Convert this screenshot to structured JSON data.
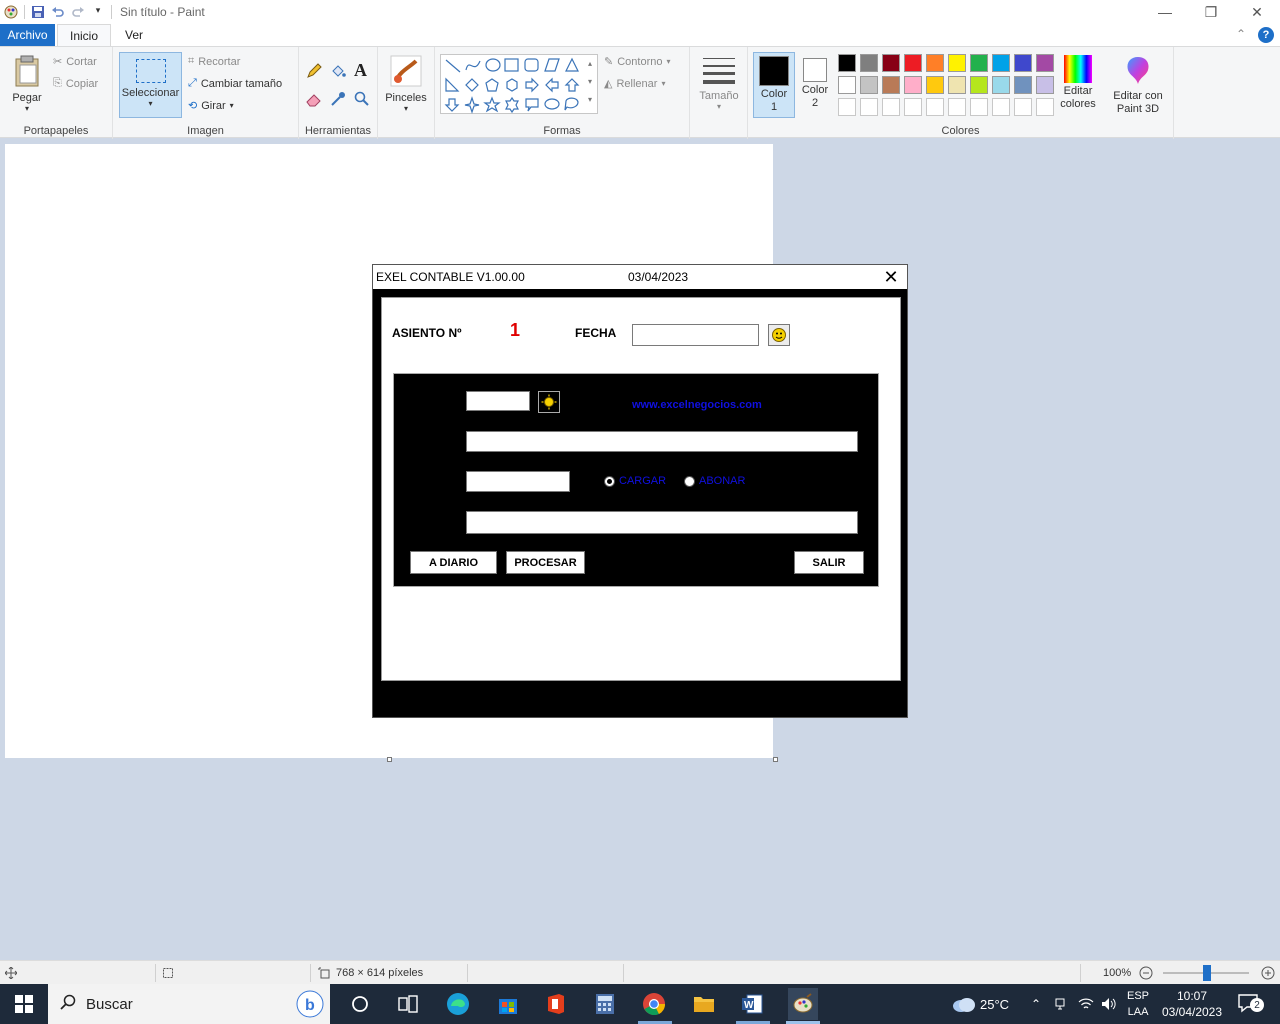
{
  "window": {
    "title": "Sin título - Paint"
  },
  "tabs": {
    "file": "Archivo",
    "home": "Inicio",
    "view": "Ver"
  },
  "clipboard": {
    "paste": "Pegar",
    "cut": "Cortar",
    "copy": "Copiar",
    "label": "Portapapeles"
  },
  "image": {
    "select": "Seleccionar",
    "crop": "Recortar",
    "resize": "Cambiar tamaño",
    "rotate": "Girar",
    "label": "Imagen"
  },
  "tools": {
    "label": "Herramientas"
  },
  "brushes": {
    "label": "Pinceles"
  },
  "shapes": {
    "outline": "Contorno",
    "fill": "Rellenar",
    "label": "Formas"
  },
  "size": {
    "label": "Tamaño"
  },
  "colors": {
    "color1": "Color 1",
    "color2": "Color 2",
    "edit": "Editar colores",
    "label": "Colores",
    "row1": [
      "#000000",
      "#7f7f7f",
      "#880015",
      "#ed1c24",
      "#ff7f27",
      "#fff200",
      "#22b14c",
      "#00a2e8",
      "#3f48cc",
      "#a349a4"
    ],
    "row2": [
      "#ffffff",
      "#c3c3c3",
      "#b97a57",
      "#ffaec9",
      "#ffc90e",
      "#efe4b0",
      "#b5e61d",
      "#99d9ea",
      "#7092be",
      "#c8bfe7"
    ]
  },
  "paint3d": {
    "label": "Editar con Paint 3D"
  },
  "dialog": {
    "title": "EXEL CONTABLE V1.00.00",
    "date": "03/04/2023",
    "asiento_label": "ASIENTO Nº",
    "asiento_num": "1",
    "fecha_label": "FECHA",
    "website": "www.excelnegocios.com",
    "radio_cargar": "CARGAR",
    "radio_abonar": "ABONAR",
    "btn_diario": "A DIARIO",
    "btn_procesar": "PROCESAR",
    "btn_salir": "SALIR"
  },
  "statusbar": {
    "dimensions": "768 × 614 píxeles",
    "zoom": "100%"
  },
  "taskbar": {
    "search": "Buscar",
    "temp": "25°C",
    "lang1": "ESP",
    "lang2": "LAA",
    "time": "10:07",
    "date": "03/04/2023",
    "notif": "2"
  }
}
